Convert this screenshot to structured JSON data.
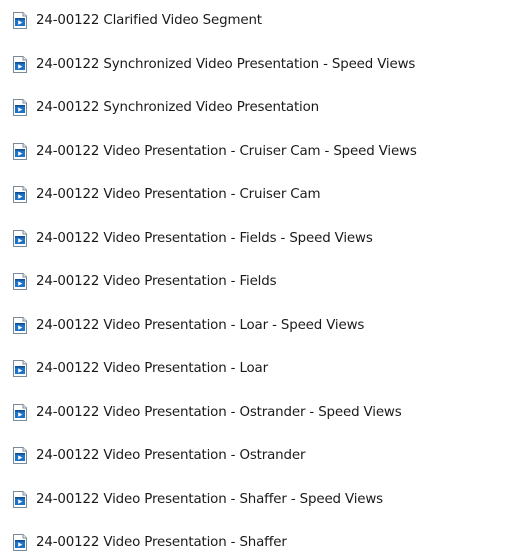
{
  "files": [
    {
      "name": "24-00122 Clarified Video Segment",
      "icon": "video-file-icon"
    },
    {
      "name": "24-00122 Synchronized Video Presentation - Speed Views",
      "icon": "video-file-icon"
    },
    {
      "name": "24-00122 Synchronized Video Presentation",
      "icon": "video-file-icon"
    },
    {
      "name": "24-00122 Video Presentation - Cruiser Cam - Speed Views",
      "icon": "video-file-icon"
    },
    {
      "name": "24-00122 Video Presentation - Cruiser Cam",
      "icon": "video-file-icon"
    },
    {
      "name": "24-00122 Video Presentation - Fields - Speed Views",
      "icon": "video-file-icon"
    },
    {
      "name": "24-00122 Video Presentation - Fields",
      "icon": "video-file-icon"
    },
    {
      "name": "24-00122 Video Presentation - Loar - Speed Views",
      "icon": "video-file-icon"
    },
    {
      "name": "24-00122 Video Presentation - Loar",
      "icon": "video-file-icon"
    },
    {
      "name": "24-00122 Video Presentation - Ostrander - Speed Views",
      "icon": "video-file-icon"
    },
    {
      "name": "24-00122 Video Presentation - Ostrander",
      "icon": "video-file-icon"
    },
    {
      "name": "24-00122 Video Presentation - Shaffer - Speed Views",
      "icon": "video-file-icon"
    },
    {
      "name": "24-00122 Video Presentation - Shaffer",
      "icon": "video-file-icon"
    }
  ],
  "colors": {
    "icon_blue": "#1e73c8",
    "icon_border": "#7a8a99",
    "text": "#1a1a1a"
  }
}
